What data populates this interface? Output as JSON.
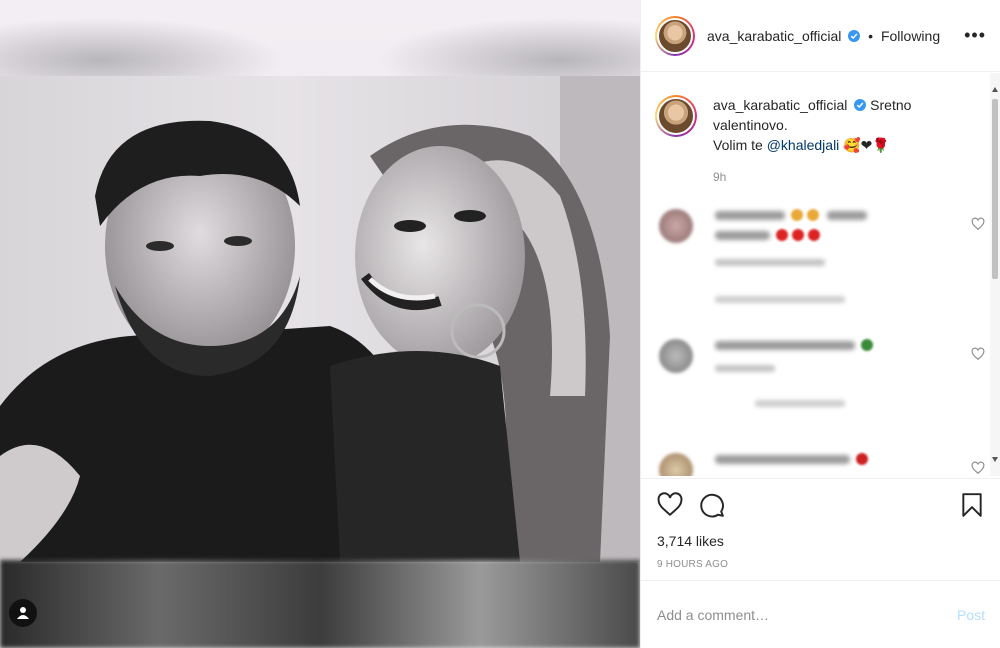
{
  "post": {
    "username": "ava_karabatic_official",
    "follow_status": "Following",
    "more_options": "•••"
  },
  "caption": {
    "username": "ava_karabatic_official",
    "text_prefix": "Sretno valentinovo.",
    "text_line2": "Volim te ",
    "mention": "@khaledjali",
    "emoji_suffix": "🥰❤🌹",
    "time": "9h"
  },
  "actions": {
    "likes": "3,714 likes",
    "time_ago": "9 HOURS AGO"
  },
  "composer": {
    "placeholder": "Add a comment…",
    "post_label": "Post"
  },
  "colors": {
    "verified": "#3897f0",
    "post_disabled": "#b2dffc",
    "meta_gray": "#8e8e8e"
  }
}
